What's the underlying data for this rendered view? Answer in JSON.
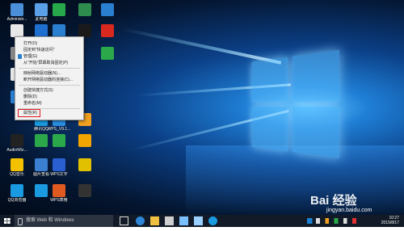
{
  "desktop": {
    "icons": [
      {
        "label": "Administr...",
        "color": "#4a8fd8"
      },
      {
        "label": "此电脑",
        "color": "#5aa0e8"
      },
      {
        "label": "",
        "color": "#27a84a"
      },
      {
        "label": "",
        "color": "#2d8c4e"
      },
      {
        "label": "",
        "color": "#2a7fd0"
      },
      {
        "label": "",
        "color": "#e8e8e8"
      },
      {
        "label": "",
        "color": "#1f6fd0"
      },
      {
        "label": "",
        "color": "#2a7fd0"
      },
      {
        "label": "",
        "color": "#1a1a1a"
      },
      {
        "label": "",
        "color": "#d9281e"
      },
      {
        "label": "",
        "color": "#888888"
      },
      {
        "label": "",
        "color": "#2ba84a"
      },
      {
        "label": "",
        "color": "#e8e8e8"
      },
      {
        "label": "",
        "color": "#2a7fd0"
      },
      {
        "label": "腾讯QQ",
        "color": "#1a9ae0"
      },
      {
        "label": "WPS_V9.1...",
        "color": "#2a8ee0"
      },
      {
        "label": "",
        "color": "#f0a020"
      },
      {
        "label": "AudioWiz...",
        "color": "#222222"
      },
      {
        "label": "",
        "color": "#2ba84a"
      },
      {
        "label": "",
        "color": "#2ba84a"
      },
      {
        "label": "",
        "color": "#f2a400"
      },
      {
        "label": "QQ音乐",
        "color": "#f3c100"
      },
      {
        "label": "图片查看",
        "color": "#3a7fd0"
      },
      {
        "label": "WPS文字",
        "color": "#2a5fd0"
      },
      {
        "label": "",
        "color": "#e0c000"
      },
      {
        "label": "QQ浏览器",
        "color": "#1a9ae0"
      },
      {
        "label": "",
        "color": "#1a9ae0"
      },
      {
        "label": "WPS表格",
        "color": "#e05a20"
      },
      {
        "label": "",
        "color": "#333333"
      }
    ]
  },
  "context_menu": {
    "items": [
      "打开(O)",
      "固定到\"快速访问\"",
      "管理(G)",
      "从\"开始\"屏幕取消固定(P)",
      "映射网络驱动器(N)...",
      "断开网络驱动器的连接(C)...",
      "创建快捷方式(S)",
      "删除(D)",
      "重命名(M)",
      "属性(R)"
    ]
  },
  "taskbar": {
    "search_placeholder": "搜索 Web 和 Windows",
    "clock_time": "10:27",
    "clock_date": "2015/8/17"
  },
  "watermark": {
    "brand": "Bai 经验",
    "url": "jingyan.baidu.com"
  }
}
